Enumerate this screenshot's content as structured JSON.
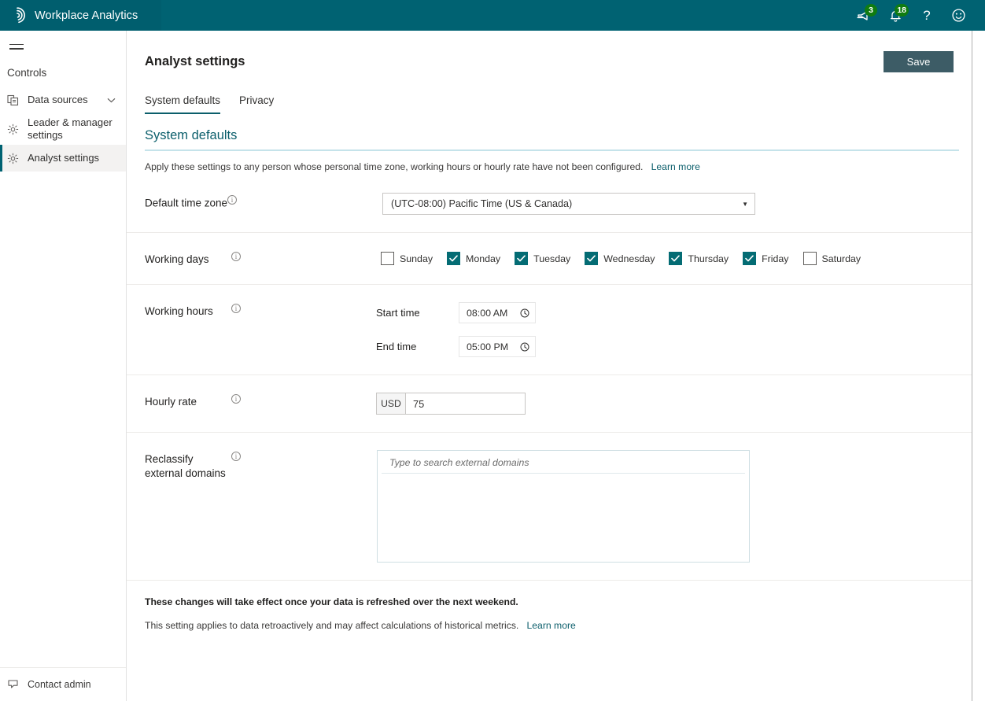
{
  "topbar": {
    "app_title": "Workplace Analytics",
    "logo_icon": "spiral-logo-icon",
    "background_color": "#006272",
    "icons": [
      {
        "name": "feedback-megaphone-icon",
        "badge": "3"
      },
      {
        "name": "notifications-bell-icon",
        "badge": "18"
      },
      {
        "name": "help-icon",
        "glyph": "?"
      },
      {
        "name": "smiley-feedback-icon",
        "glyph": "☺"
      }
    ],
    "badge_color": "#107c10"
  },
  "sidebar": {
    "menu_icon": "hamburger-menu-icon",
    "section_label": "Controls",
    "items": [
      {
        "label": "Data sources",
        "icon": "data-sources-icon",
        "chevron": "chevron-down-icon",
        "active": false
      },
      {
        "label": "Leader & manager settings",
        "icon": "gear-icon",
        "active": false
      },
      {
        "label": "Analyst settings",
        "icon": "gear-icon",
        "active": true
      }
    ],
    "bottom_item": {
      "label": "Contact admin",
      "icon": "contact-admin-icon"
    },
    "active_accent_color": "#006272"
  },
  "page": {
    "title": "Analyst settings",
    "save_label": "Save",
    "save_color": "#3d5c66",
    "tabs": [
      {
        "label": "System defaults",
        "active": true
      },
      {
        "label": "Privacy",
        "active": false
      }
    ],
    "section_heading": "System defaults",
    "section_heading_color": "#0b5e6b",
    "description": "Apply these settings to any person whose personal time zone, working hours or hourly rate have not been configured.",
    "description_link": "Learn more"
  },
  "form": {
    "time_zone": {
      "label": "Default time zone",
      "info_icon": "info-icon",
      "value": "(UTC-08:00) Pacific Time (US & Canada)",
      "caret_icon": "chevron-down-icon"
    },
    "working_days": {
      "label": "Working days",
      "info_icon": "info-icon",
      "days": [
        {
          "label": "Sunday",
          "checked": false
        },
        {
          "label": "Monday",
          "checked": true
        },
        {
          "label": "Tuesday",
          "checked": true
        },
        {
          "label": "Wednesday",
          "checked": true
        },
        {
          "label": "Thursday",
          "checked": true
        },
        {
          "label": "Friday",
          "checked": true
        },
        {
          "label": "Saturday",
          "checked": false
        }
      ],
      "checked_color": "#046C74"
    },
    "working_hours": {
      "label": "Working hours",
      "info_icon": "info-icon",
      "start_label": "Start time",
      "start_value": "08:00 AM",
      "end_label": "End time",
      "end_value": "05:00 PM",
      "clock_icon": "clock-icon"
    },
    "hourly_rate": {
      "label": "Hourly rate",
      "info_icon": "info-icon",
      "currency": "USD",
      "value": "75"
    },
    "external_domains": {
      "label_line1": "Reclassify",
      "label_line2": "external domains",
      "info_icon": "info-icon",
      "placeholder": "Type to search external domains",
      "value": ""
    }
  },
  "footer": {
    "notice": "These changes will take effect once your data is refreshed over the next weekend.",
    "note": "This setting applies to data retroactively and may affect calculations of historical metrics.",
    "note_link": "Learn more"
  }
}
